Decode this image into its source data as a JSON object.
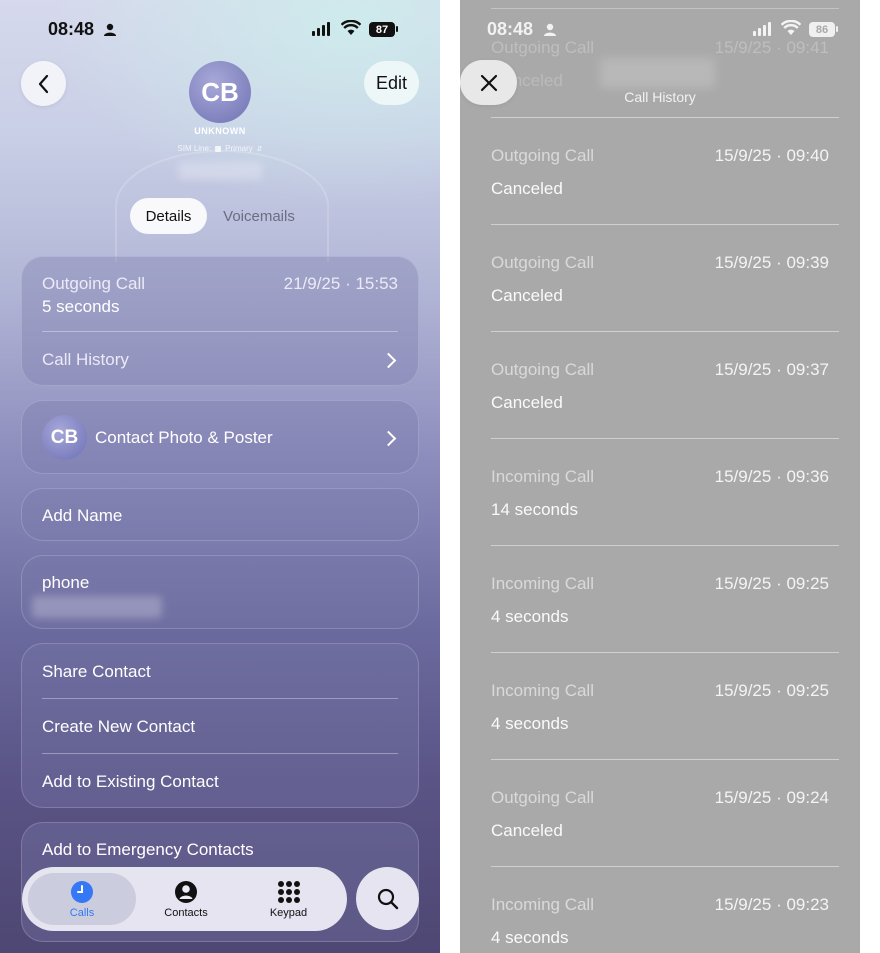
{
  "left": {
    "status": {
      "time": "08:48",
      "battery": "87"
    },
    "header": {
      "avatar_initials": "CB",
      "subtitle": "UNKNOWN",
      "sim_line_label": "SIM Line:",
      "sim_line_value": "Primary",
      "edit_label": "Edit"
    },
    "tabs": [
      {
        "label": "Details",
        "selected": true
      },
      {
        "label": "Voicemails",
        "selected": false
      }
    ],
    "call_card": {
      "type": "Outgoing Call",
      "datetime": "21/9/25 · 15:53",
      "duration": "5 seconds",
      "history_label": "Call History"
    },
    "contact_photo": {
      "initials": "CB",
      "label": "Contact Photo & Poster"
    },
    "add_name_label": "Add Name",
    "phone_label": "phone",
    "actions": [
      "Share Contact",
      "Create New Contact",
      "Add to Existing Contact"
    ],
    "emergency_label": "Add to Emergency Contacts",
    "tabbar": [
      {
        "label": "Calls",
        "icon": "clock-icon",
        "active": true
      },
      {
        "label": "Contacts",
        "icon": "person-icon",
        "active": false
      },
      {
        "label": "Keypad",
        "icon": "keypad-icon",
        "active": false
      }
    ],
    "colors": {
      "accent": "#3478f6"
    }
  },
  "right": {
    "status": {
      "time": "08:48",
      "battery": "86"
    },
    "title": "Call History",
    "ghost": {
      "type": "Outgoing Call",
      "datetime": "15/9/25 · 09:41",
      "duration": "Canceled"
    },
    "entries": [
      {
        "type": "Outgoing Call",
        "datetime": "15/9/25 · 09:40",
        "duration": "Canceled"
      },
      {
        "type": "Outgoing Call",
        "datetime": "15/9/25 · 09:39",
        "duration": "Canceled"
      },
      {
        "type": "Outgoing Call",
        "datetime": "15/9/25 · 09:37",
        "duration": "Canceled"
      },
      {
        "type": "Incoming Call",
        "datetime": "15/9/25 · 09:36",
        "duration": "14 seconds"
      },
      {
        "type": "Incoming Call",
        "datetime": "15/9/25 · 09:25",
        "duration": "4 seconds"
      },
      {
        "type": "Incoming Call",
        "datetime": "15/9/25 · 09:25",
        "duration": "4 seconds"
      },
      {
        "type": "Outgoing Call",
        "datetime": "15/9/25 · 09:24",
        "duration": "Canceled"
      },
      {
        "type": "Incoming Call",
        "datetime": "15/9/25 · 09:23",
        "duration": "4 seconds"
      }
    ]
  }
}
